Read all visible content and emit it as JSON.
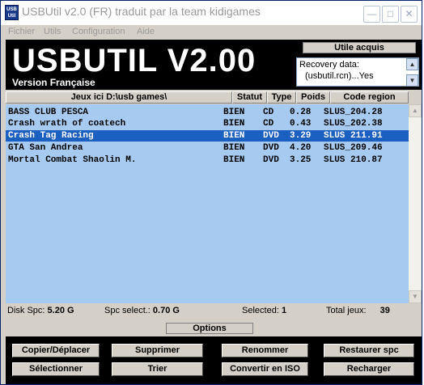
{
  "window": {
    "title": "USBUtil v2.0 (FR) traduit par la team kidigames",
    "icon_label": "USB Util"
  },
  "menu": [
    "Fichier",
    "Utils",
    "Configuration",
    "Aide"
  ],
  "header": {
    "app_name": "USBUTIL V2.00",
    "subtitle": "Version Française",
    "utile_button": "Utile acquis",
    "recovery_line1": "Recovery data:",
    "recovery_line2": "(usbutil.rcn)...Yes"
  },
  "columns": {
    "game": "Jeux ici D:\\usb games\\",
    "status": "Statut",
    "type": "Type",
    "size": "Poids",
    "region": "Code region"
  },
  "games": [
    {
      "name": "BASS CLUB PESCA",
      "status": "BIEN",
      "type": "CD",
      "size": "0.28",
      "code": "SLUS_204.28",
      "selected": false
    },
    {
      "name": "Crash wrath of coatech",
      "status": "BIEN",
      "type": "CD",
      "size": "0.43",
      "code": "SLUS_202.38",
      "selected": false
    },
    {
      "name": "Crash Tag Racing",
      "status": "BIEN",
      "type": "DVD",
      "size": "3.29",
      "code": "SLUS 211.91",
      "selected": true
    },
    {
      "name": "GTA San Andrea",
      "status": "BIEN",
      "type": "DVD",
      "size": "4.20",
      "code": "SLUS_209.46",
      "selected": false
    },
    {
      "name": "Mortal Combat Shaolin M.",
      "status": "BIEN",
      "type": "DVD",
      "size": "3.25",
      "code": "SLUS 210.87",
      "selected": false
    }
  ],
  "status_bar": {
    "disk_label": "Disk Spc:",
    "disk_value": "5.20 G",
    "spc_label": "Spc select.:",
    "spc_value": "0.70 G",
    "selected_label": "Selected:",
    "selected_value": "1",
    "total_label": "Total jeux:",
    "total_value": "39"
  },
  "options_label": "Options",
  "buttons": {
    "copy": "Copier/Déplacer",
    "delete": "Supprimer",
    "rename": "Renommer",
    "restore": "Restaurer spc",
    "select": "Sélectionner",
    "sort": "Trier",
    "convert": "Convertir en ISO",
    "reload": "Recharger"
  },
  "colors": {
    "list_bg": "#a6caf0",
    "selection": "#1b5fc0",
    "header_bg": "#000000",
    "face": "#d4d0c8"
  },
  "icons": [
    "app-icon",
    "minimize-icon",
    "maximize-icon",
    "close-icon",
    "scroll-up-icon",
    "scroll-down-icon"
  ]
}
